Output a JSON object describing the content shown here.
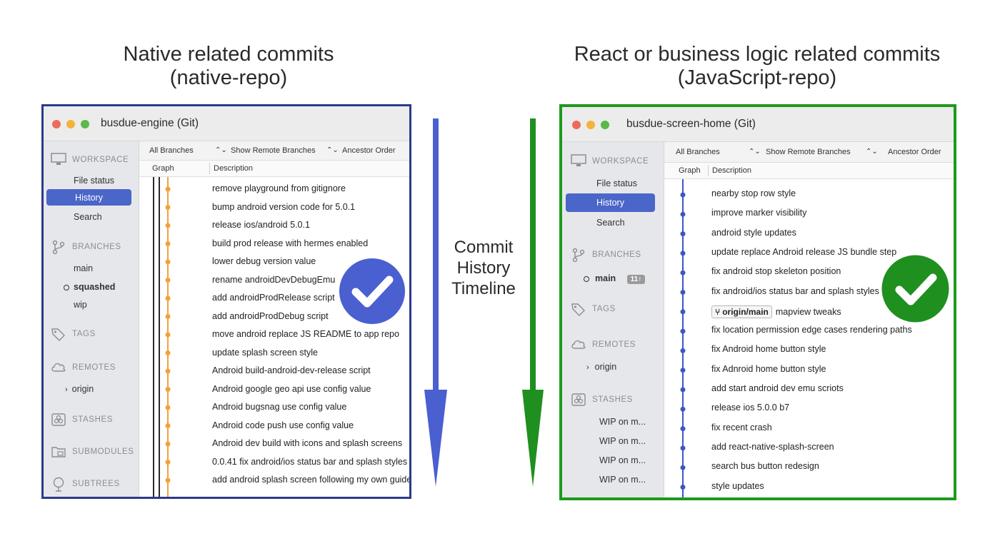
{
  "headings": {
    "left": [
      "Native related commits",
      "(native-repo)"
    ],
    "right": [
      "React or business logic related commits",
      "(JavaScript-repo)"
    ]
  },
  "middle_label": [
    "Commit",
    "History",
    "Timeline"
  ],
  "colors": {
    "left_accent": "#4a5fd0",
    "left_border": "#2c3a8c",
    "right_accent": "#1f8f1f",
    "right_border": "#1d9a1d",
    "sidebar_selected": "#4b66c9",
    "left_graph_line": "#f1a23a",
    "right_graph_line": "#3d56c4"
  },
  "left_window": {
    "title": "busdue-engine (Git)",
    "sidebar": {
      "workspace": "WORKSPACE",
      "file_status": "File status",
      "history": "History",
      "search": "Search",
      "branches": "BRANCHES",
      "branch_items": [
        "main",
        "squashed",
        "wip"
      ],
      "tags": "TAGS",
      "remotes": "REMOTES",
      "remote_item": "origin",
      "stashes": "STASHES",
      "submodules": "SUBMODULES",
      "subtrees": "SUBTREES"
    },
    "toolbar": {
      "branches": "All Branches",
      "remote": "Show Remote Branches",
      "order": "Ancestor Order"
    },
    "columns": {
      "graph": "Graph",
      "description": "Description"
    },
    "commits": [
      "remove playground from gitignore",
      "bump android version code for 5.0.1",
      "release ios/android 5.0.1",
      "build prod release with hermes enabled",
      "lower debug version value",
      "rename androidDevDebugEmu",
      "add androidProdRelease script",
      "add androidProdDebug script",
      "move android replace JS README to app repo",
      "update splash screen style",
      "Android build-android-dev-release script",
      "Android google geo api use config value",
      "Android bugsnag use config value",
      "Android code push use config value",
      "Android dev build with icons and splash screens",
      "0.0.41 fix android/ios status bar and splash styles",
      "add android splash screen following my own guide"
    ]
  },
  "right_window": {
    "title": "busdue-screen-home (Git)",
    "sidebar": {
      "workspace": "WORKSPACE",
      "file_status": "File status",
      "history": "History",
      "search": "Search",
      "branches": "BRANCHES",
      "branch_item": "main",
      "branch_badge": "11↑",
      "tags": "TAGS",
      "remotes": "REMOTES",
      "remote_item": "origin",
      "stashes": "STASHES",
      "stash_items": [
        "WIP on m...",
        "WIP on m...",
        "WIP on m...",
        "WIP on m..."
      ]
    },
    "toolbar": {
      "branches": "All Branches",
      "remote": "Show Remote Branches",
      "order": "Ancestor Order"
    },
    "columns": {
      "graph": "Graph",
      "description": "Description"
    },
    "origin_badge": "origin/main",
    "commits": [
      "nearby stop row style",
      "improve marker visibility",
      "android style updates",
      "update replace Android release JS bundle step",
      "fix android stop skeleton position",
      "fix android/ios status bar and splash styles",
      "mapview tweaks",
      "fix location permission edge cases rendering paths",
      "fix Android home button style",
      "fix Adnroid home button style",
      "add start android dev emu scriots",
      "release ios 5.0.0 b7",
      "fix recent crash",
      "add react-native-splash-screen",
      "search bus button redesign",
      "style updates"
    ]
  }
}
